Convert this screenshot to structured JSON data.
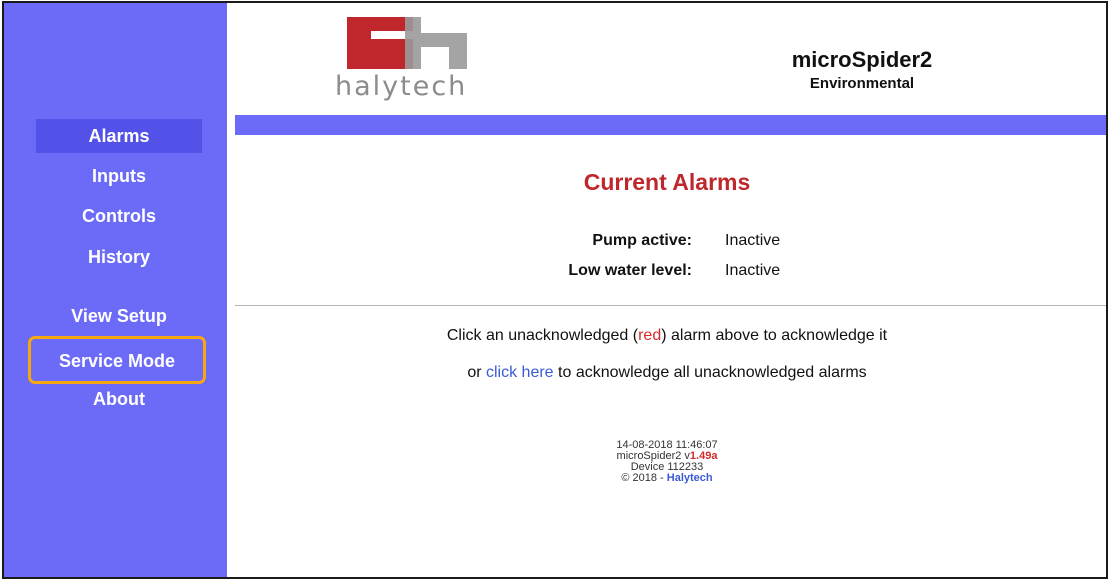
{
  "nav": {
    "items": [
      {
        "label": "Alarms"
      },
      {
        "label": "Inputs"
      },
      {
        "label": "Controls"
      },
      {
        "label": "History"
      },
      {
        "label": "View Setup"
      },
      {
        "label": "Service Mode"
      },
      {
        "label": "About"
      }
    ]
  },
  "brand": {
    "logo_text": "halytech",
    "logo_icon": "halytech-logo-icon",
    "colors": {
      "logo_red": "#c0272d",
      "logo_grey": "#9a9a9a"
    }
  },
  "device": {
    "name": "microSpider2",
    "type": "Environmental"
  },
  "page": {
    "title": "Current Alarms",
    "alarms": [
      {
        "label": "Pump active:",
        "value": "Inactive"
      },
      {
        "label": "Low water level:",
        "value": "Inactive"
      }
    ],
    "message1": {
      "prefix": "Click an unacknowledged (",
      "red_word": "red",
      "suffix": ") alarm above to acknowledge it"
    },
    "message2": {
      "prefix": "or ",
      "link": "click here",
      "suffix": " to acknowledge all unacknowledged alarms"
    }
  },
  "footer": {
    "timestamp": "14-08-2018  11:46:07",
    "version_prefix": "microSpider2 v",
    "version": "1.49a",
    "device": "Device 112233",
    "copyright": "© 2018 - ",
    "company": "Halytech"
  },
  "colors": {
    "sidebar": "#6b6bf7",
    "active_nav": "#5252e8",
    "highlight": "#f6a712",
    "title_red": "#c0272d",
    "link_blue": "#3b5bd6"
  }
}
